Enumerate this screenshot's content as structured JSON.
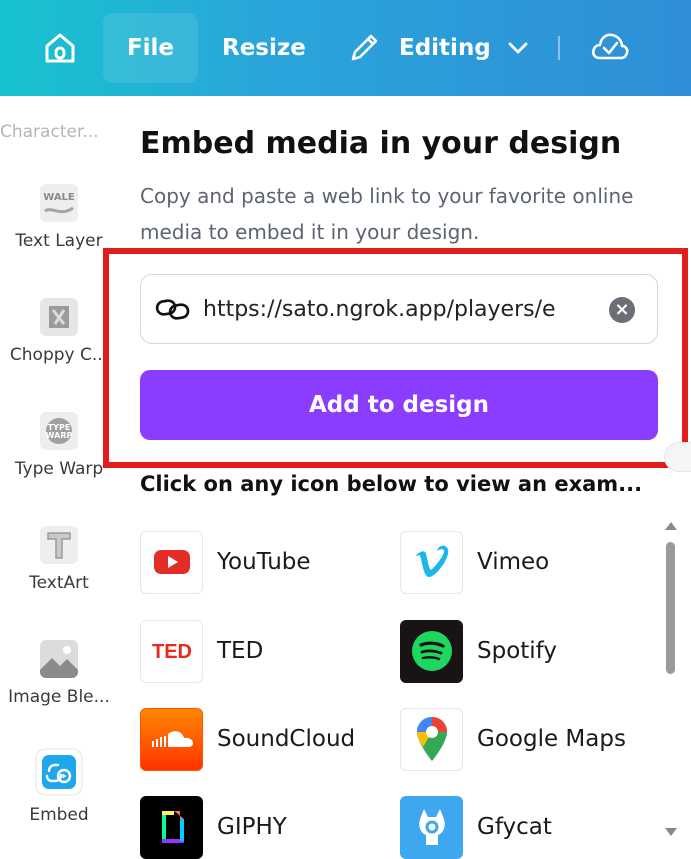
{
  "topbar": {
    "file_label": "File",
    "resize_label": "Resize",
    "editing_label": "Editing"
  },
  "sidebar": {
    "partial_label": "Character...",
    "items": [
      {
        "label": "Text Layer",
        "icon": "text-layer-thumbnail"
      },
      {
        "label": "Choppy C...",
        "icon": "choppy-thumbnail"
      },
      {
        "label": "Type Warp",
        "icon": "type-warp-thumbnail"
      },
      {
        "label": "TextArt",
        "icon": "textart-thumbnail"
      },
      {
        "label": "Image Ble...",
        "icon": "image-blend-thumbnail"
      },
      {
        "label": "Embed",
        "icon": "embed-icon"
      }
    ]
  },
  "panel": {
    "title": "Embed media in your design",
    "description": "Copy and paste a web link to your favorite online media to embed it in your design.",
    "url_value": "https://sato.ngrok.app/players/e",
    "add_button_label": "Add to design",
    "examples_title": "Click on any icon below to view an exam..."
  },
  "media": [
    {
      "label": "YouTube",
      "color": "#e52d27"
    },
    {
      "label": "Vimeo",
      "color": "#1ab7ea"
    },
    {
      "label": "TED",
      "color": "#e62b1e"
    },
    {
      "label": "Spotify",
      "color": "#1ed760"
    },
    {
      "label": "SoundCloud",
      "color": "#ff5500"
    },
    {
      "label": "Google Maps",
      "color": "#4285f4"
    },
    {
      "label": "GIPHY",
      "color": "#000000"
    },
    {
      "label": "Gfycat",
      "color": "#3da8ef"
    }
  ],
  "colors": {
    "accent": "#8b3dff",
    "highlight": "#e21b1b"
  }
}
